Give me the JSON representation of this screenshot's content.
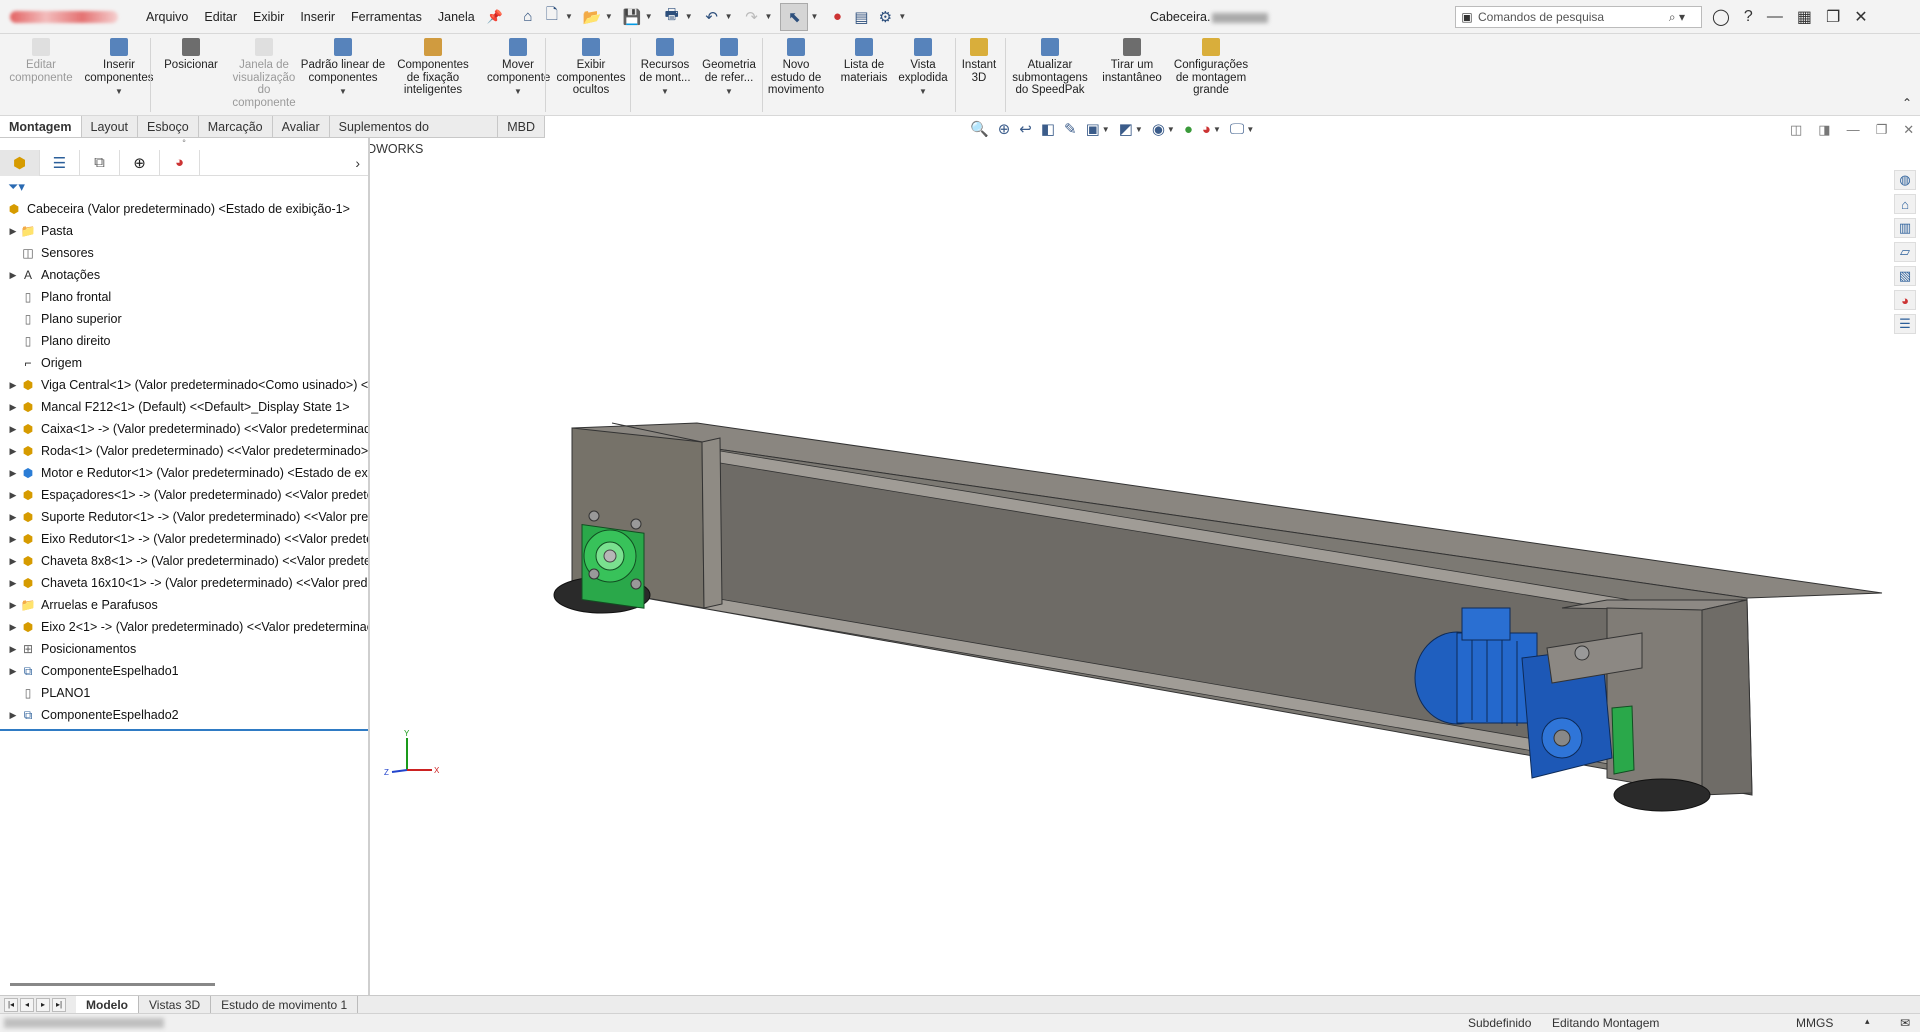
{
  "menu": [
    "Arquivo",
    "Editar",
    "Exibir",
    "Inserir",
    "Ferramentas",
    "Janela"
  ],
  "document_title": "Cabeceira.",
  "search": {
    "placeholder": "Comandos de pesquisa"
  },
  "ribbon": [
    {
      "label": "Editar\ncomponente",
      "disabled": true,
      "icon": "edit-component-icon"
    },
    {
      "label": "Inserir\ncomponentes",
      "disabled": false,
      "icon": "insert-components-icon"
    },
    {
      "label": "Posicionar",
      "disabled": false,
      "icon": "mate-icon"
    },
    {
      "label": "Janela de\nvisualização\ndo\ncomponente",
      "disabled": true,
      "icon": "component-preview-icon"
    },
    {
      "label": "Padrão linear de\ncomponentes",
      "disabled": false,
      "icon": "linear-pattern-icon"
    },
    {
      "label": "Componentes\nde fixação\ninteligentes",
      "disabled": false,
      "icon": "smart-fasteners-icon"
    },
    {
      "label": "Mover\ncomponente",
      "disabled": false,
      "icon": "move-component-icon"
    },
    {
      "label": "Exibir\ncomponentes\nocultos",
      "disabled": false,
      "icon": "show-hidden-icon"
    },
    {
      "label": "Recursos\nde mont...",
      "disabled": false,
      "icon": "assembly-features-icon"
    },
    {
      "label": "Geometria\nde refer...",
      "disabled": false,
      "icon": "reference-geometry-icon"
    },
    {
      "label": "Novo\nestudo de\nmovimento",
      "disabled": false,
      "icon": "motion-study-icon"
    },
    {
      "label": "Lista de\nmateriais",
      "disabled": false,
      "icon": "bom-icon"
    },
    {
      "label": "Vista\nexplodida",
      "disabled": false,
      "icon": "exploded-view-icon"
    },
    {
      "label": "Instant\n3D",
      "disabled": false,
      "icon": "instant3d-icon"
    },
    {
      "label": "Atualizar\nsubmontagens\ndo SpeedPak",
      "disabled": false,
      "icon": "speedpak-icon"
    },
    {
      "label": "Tirar um\ninstantâneo",
      "disabled": false,
      "icon": "camera-icon"
    },
    {
      "label": "Configurações\nde montagem\ngrande",
      "disabled": false,
      "icon": "large-assembly-icon"
    }
  ],
  "tabs": [
    "Montagem",
    "Layout",
    "Esboço",
    "Marcação",
    "Avaliar",
    "Suplementos do SOLIDWORKS",
    "MBD"
  ],
  "active_tab": "Montagem",
  "tree": {
    "root": "Cabeceira (Valor predeterminado) <Estado de exibição-1>",
    "items": [
      {
        "label": "Pasta",
        "expandable": true,
        "icon": "folder-icon"
      },
      {
        "label": "Sensores",
        "expandable": false,
        "icon": "sensor-icon"
      },
      {
        "label": "Anotações",
        "expandable": true,
        "icon": "annotation-icon"
      },
      {
        "label": "Plano frontal",
        "expandable": false,
        "icon": "plane-icon"
      },
      {
        "label": "Plano superior",
        "expandable": false,
        "icon": "plane-icon"
      },
      {
        "label": "Plano direito",
        "expandable": false,
        "icon": "plane-icon"
      },
      {
        "label": "Origem",
        "expandable": false,
        "icon": "origin-icon"
      },
      {
        "label": "Viga Central<1> (Valor predeterminado<Como usinado>) <",
        "expandable": true,
        "icon": "part-icon"
      },
      {
        "label": "Mancal F212<1> (Default) <<Default>_Display State 1>",
        "expandable": true,
        "icon": "part-icon"
      },
      {
        "label": "Caixa<1> -> (Valor predeterminado) <<Valor predeterminad",
        "expandable": true,
        "icon": "part-icon"
      },
      {
        "label": "Roda<1> (Valor predeterminado) <<Valor predeterminado>_",
        "expandable": true,
        "icon": "part-icon"
      },
      {
        "label": "Motor e Redutor<1> (Valor predeterminado) <Estado de exib",
        "expandable": true,
        "icon": "subassembly-icon"
      },
      {
        "label": "Espaçadores<1> -> (Valor predeterminado) <<Valor predete",
        "expandable": true,
        "icon": "part-icon"
      },
      {
        "label": "Suporte Redutor<1> -> (Valor predeterminado) <<Valor pre",
        "expandable": true,
        "icon": "part-icon"
      },
      {
        "label": "Eixo Redutor<1> -> (Valor predeterminado) <<Valor predete",
        "expandable": true,
        "icon": "part-icon"
      },
      {
        "label": "Chaveta 8x8<1> -> (Valor predeterminado) <<Valor predetei",
        "expandable": true,
        "icon": "part-icon"
      },
      {
        "label": "Chaveta 16x10<1> -> (Valor predeterminado) <<Valor prede",
        "expandable": true,
        "icon": "part-icon"
      },
      {
        "label": "Arruelas e Parafusos",
        "expandable": true,
        "icon": "folder-icon"
      },
      {
        "label": "Eixo 2<1> -> (Valor predeterminado) <<Valor predeterminac",
        "expandable": true,
        "icon": "part-icon"
      },
      {
        "label": "Posicionamentos",
        "expandable": true,
        "icon": "mates-icon"
      },
      {
        "label": "ComponenteEspelhado1",
        "expandable": true,
        "icon": "mirror-icon"
      },
      {
        "label": "PLANO1",
        "expandable": false,
        "icon": "plane-icon"
      },
      {
        "label": "ComponenteEspelhado2",
        "expandable": true,
        "icon": "mirror-icon"
      }
    ]
  },
  "bottom_tabs": [
    "Modelo",
    "Vistas 3D",
    "Estudo de movimento 1"
  ],
  "active_bottom_tab": "Modelo",
  "status": {
    "state": "Subdefinido",
    "mode": "Editando Montagem",
    "units": "MMGS"
  },
  "triad": {
    "x": "X",
    "y": "Y",
    "z": "Z"
  }
}
